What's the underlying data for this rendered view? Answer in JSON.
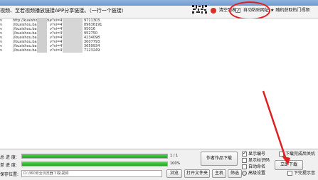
{
  "window": {
    "title": ""
  },
  "toolbar": {
    "prompt": "视频、至若视频播放链接APP分享链接。（一行一个链接）",
    "clear_label": "清空列表",
    "auto_paste_label": "自动粘贴网址",
    "random_label": "随机获取热门视频",
    "colors": {
      "clear_dot": "#d93025",
      "random_icon": "#444444",
      "annotation": "#e02020"
    }
  },
  "links": [
    {
      "prefix": "v",
      "text": "http://kuaishou.baidu",
      "code": "v?vi=4*6542",
      "num": "9711303"
    },
    {
      "prefix": "v",
      "text": "//kuaishou.baidu",
      "code": "v?vi=4*6258",
      "num": "89636191"
    },
    {
      "prefix": "v",
      "text": "//kuaishou.baidu",
      "code": "v?vi=4*6404",
      "num": "95016"
    },
    {
      "prefix": "v",
      "text": "//kuaishou.baidu",
      "code": "v?vi=4*6549",
      "num": "952750"
    },
    {
      "prefix": "v",
      "text": "//kuaishou.baidu",
      "code": "v?vi=4*8489",
      "num": "4234098"
    },
    {
      "prefix": "v",
      "text": "//kuaishou.baidu",
      "code": "v?vi=4*8580",
      "num": "3007793"
    },
    {
      "prefix": "v",
      "text": "//kuaishou.baidu",
      "code": "v?vi=4*8134",
      "num": "3659934"
    },
    {
      "prefix": "v",
      "text": "//kuaishou.baidu",
      "code": "v?vi=4*4300",
      "num": "7123249"
    }
  ],
  "progress": {
    "total_label": "总 进 度:",
    "total_fraction": 1.0,
    "total_text": "1 / 1",
    "single_label": "单 进 度:",
    "single_fraction": 1.0,
    "single_text": "100%"
  },
  "save": {
    "label": "保存位置:",
    "path": "D:\\360安全浏览器下载\\视频",
    "browse_label": "浏览",
    "open_folder_label": "打开文件夹"
  },
  "actions": {
    "author_download_label": "作者作品下载",
    "stop_label": "主机",
    "select_label": "筛选",
    "start_download_label": "立即下载"
  },
  "options": {
    "show_number": {
      "label": "显示编号",
      "checked": true
    },
    "show_marks": {
      "label": "显示标识码",
      "checked": false
    },
    "auto_rename": {
      "label": "自动命名",
      "checked": false
    },
    "advanced": {
      "label": "高级设置"
    },
    "finish_shutdown": {
      "label": "下载完成后关机",
      "checked": false
    },
    "hide_to_tray": {
      "label": "下完提示音",
      "checked": false
    }
  }
}
